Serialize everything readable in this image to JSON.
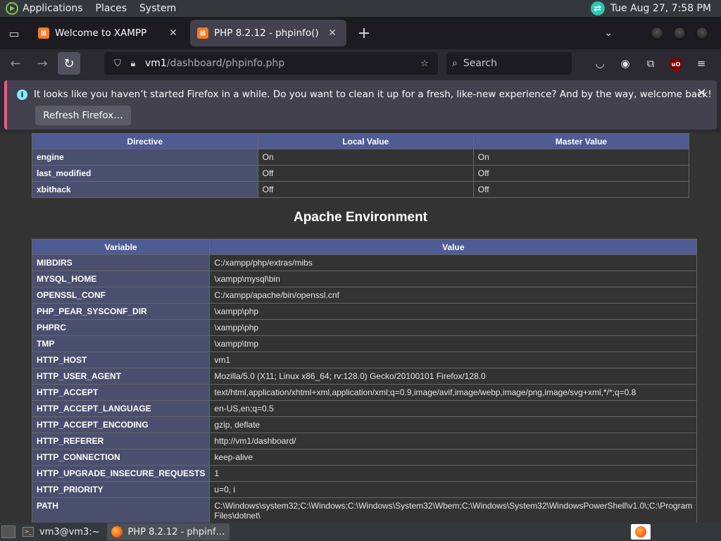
{
  "top_panel": {
    "menus": [
      "Applications",
      "Places",
      "System"
    ],
    "datetime": "Tue Aug 27,  7:58 PM"
  },
  "browser": {
    "tabs": [
      {
        "title": "Welcome to XAMPP",
        "active": false
      },
      {
        "title": "PHP 8.2.12 - phpinfo()",
        "active": true
      }
    ],
    "url_host": "vm1",
    "url_path": "/dashboard/phpinfo.php",
    "search_placeholder": "Search"
  },
  "notification": {
    "message": "It looks like you haven’t started Firefox in a while. Do you want to clean it up for a fresh, like-new experience? And by the way, welcome back!",
    "button": "Refresh Firefox…"
  },
  "page": {
    "ssi_table": {
      "headers": [
        "Directive",
        "Local Value",
        "Master Value"
      ],
      "rows": [
        [
          "engine",
          "On",
          "On"
        ],
        [
          "last_modified",
          "Off",
          "Off"
        ],
        [
          "xbithack",
          "Off",
          "Off"
        ]
      ]
    },
    "apache_title": "Apache Environment",
    "env_table": {
      "headers": [
        "Variable",
        "Value"
      ],
      "rows": [
        [
          "MIBDIRS",
          "C:/xampp/php/extras/mibs"
        ],
        [
          "MYSQL_HOME",
          "\\xampp\\mysql\\bin"
        ],
        [
          "OPENSSL_CONF",
          "C:/xampp/apache/bin/openssl.cnf"
        ],
        [
          "PHP_PEAR_SYSCONF_DIR",
          "\\xampp\\php"
        ],
        [
          "PHPRC",
          "\\xampp\\php"
        ],
        [
          "TMP",
          "\\xampp\\tmp"
        ],
        [
          "HTTP_HOST",
          "vm1"
        ],
        [
          "HTTP_USER_AGENT",
          "Mozilla/5.0 (X11; Linux x86_64; rv:128.0) Gecko/20100101 Firefox/128.0"
        ],
        [
          "HTTP_ACCEPT",
          "text/html,application/xhtml+xml,application/xml;q=0.9,image/avif,image/webp,image/png,image/svg+xml,*/*;q=0.8"
        ],
        [
          "HTTP_ACCEPT_LANGUAGE",
          "en-US,en;q=0.5"
        ],
        [
          "HTTP_ACCEPT_ENCODING",
          "gzip, deflate"
        ],
        [
          "HTTP_REFERER",
          "http://vm1/dashboard/"
        ],
        [
          "HTTP_CONNECTION",
          "keep-alive"
        ],
        [
          "HTTP_UPGRADE_INSECURE_REQUESTS",
          "1"
        ],
        [
          "HTTP_PRIORITY",
          "u=0, i"
        ],
        [
          "PATH",
          "C:\\Windows\\system32;C:\\Windows;C:\\Windows\\System32\\Wbem;C:\\Windows\\System32\\WindowsPowerShell\\v1.0\\;C:\\Program Files\\dotnet\\"
        ]
      ]
    }
  },
  "taskbar": {
    "tasks": [
      {
        "label": "vm3@vm3:~",
        "active": false
      },
      {
        "label": "PHP 8.2.12 - phpinf…",
        "active": true
      }
    ]
  }
}
